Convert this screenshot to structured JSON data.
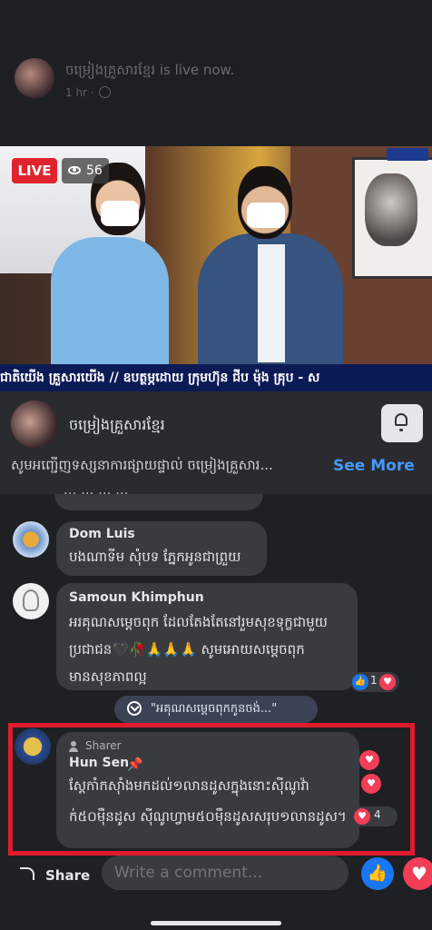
{
  "post": {
    "page_name": "ចម្រៀងគ្រួសារខ្មែរ",
    "status": "is live now.",
    "time": "1 hr ·"
  },
  "video": {
    "live_label": "LIVE",
    "viewer_count": "56",
    "ticker": "ជាតិយើង គ្រួសារយើង // ឧបត្ថម្ភដោយ ក្រុមហ៊ុន ជីប ម៉ុង គ្រុប - ស"
  },
  "page_bar": {
    "name": "ចម្រៀងគ្រួសារខ្មែរ",
    "description": "សូមអញ្ជើញទស្សនាការផ្សាយផ្ទាល់ ចម្រៀងគ្រួសារ...",
    "see_more": "See More"
  },
  "comments": [
    {
      "name": "",
      "text": "... ... ... ..."
    },
    {
      "name": "Dom Luis",
      "text": "បងណាទីម សុំបទ ភ្នែកអូនជាព្រួយ"
    },
    {
      "name": "Samoun Khimphun",
      "line1": "អរគុណសម្តេចពុក ដែលតែងតែនៅរួមសុខទុក្ខជាមួយ",
      "line2": "ប្រជាជន🖤🥀🙏🙏🙏 សូមអោយសម្ដេចពុក",
      "line3": "មានសុខភាពល្អ",
      "reaction_count": "1"
    },
    {
      "badge": "Sharer",
      "name": "Hun Sen",
      "line1": "ស្តែកាំកស៊ាំងមកដល់១លានដូសក្នុងនោះស៊ីណូវ៉ា",
      "line2": "ក់៥០ម៉ឺនដូស ស៊ីណូហ្វាម៥០ម៉ឺនដូសសរុប១លានដូស។",
      "reaction_count": "4"
    }
  ],
  "new_comments_pill": "\"អគុណសម្ដេចពុកកូនចង់...\"",
  "bottom_bar": {
    "share_label": "Share",
    "comment_placeholder": "Write a comment..."
  },
  "colors": {
    "live": "#e0242e",
    "like": "#1877f2",
    "love": "#f33e58",
    "highlight": "#e01b2e",
    "see_more": "#4599ff"
  }
}
